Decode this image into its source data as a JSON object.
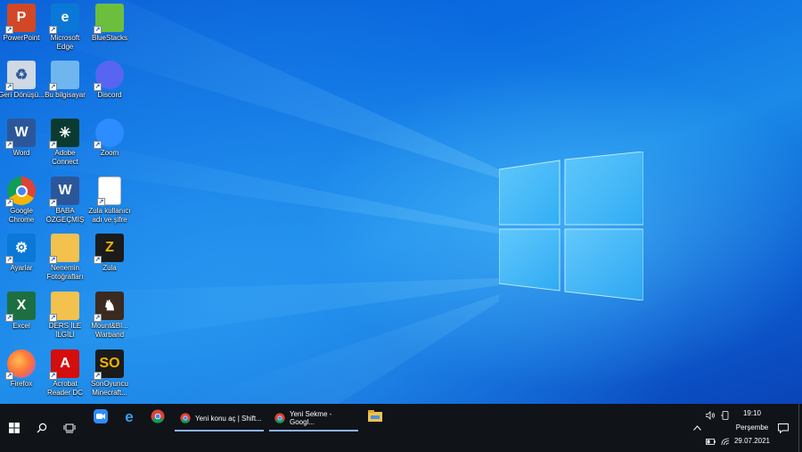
{
  "desktop": {
    "icons": [
      {
        "label": "PowerPoint",
        "icon": "powerpoint-icon",
        "glyph": "P",
        "color": "#d24726"
      },
      {
        "label": "Microsoft Edge",
        "icon": "edge-icon",
        "glyph": "e",
        "color": "#0a78d7"
      },
      {
        "label": "BlueStacks",
        "icon": "bluestacks-icon",
        "glyph": "",
        "color": "#6bbf3c"
      },
      {
        "label": "Geri Dönüşü...",
        "icon": "recycle-bin-icon",
        "glyph": "♻",
        "color": "#cfd8e3"
      },
      {
        "label": "Bu bilgisayar",
        "icon": "this-pc-icon",
        "glyph": "",
        "color": "#6fb6f0"
      },
      {
        "label": "Discord",
        "icon": "discord-icon",
        "glyph": "",
        "color": "#5865f2"
      },
      {
        "label": "Word",
        "icon": "word-icon",
        "glyph": "W",
        "color": "#2b579a"
      },
      {
        "label": "Adobe Connect",
        "icon": "adobe-connect-icon",
        "glyph": "✳",
        "color": "#0b3b30"
      },
      {
        "label": "Zoom",
        "icon": "zoom-icon",
        "glyph": "",
        "color": "#2d8cff"
      },
      {
        "label": "Google Chrome",
        "icon": "chrome-icon",
        "glyph": "",
        "color": "#ffffff"
      },
      {
        "label": "BABA ÖZGEÇMİŞ",
        "icon": "word-document-icon",
        "glyph": "W",
        "color": "#2b579a"
      },
      {
        "label": "Zula kullanıcı adı ve şifre",
        "icon": "text-file-icon",
        "glyph": "",
        "color": "#ffffff"
      },
      {
        "label": "Ayarlar",
        "icon": "settings-gear-icon",
        "glyph": "⚙",
        "color": "#0a78d7"
      },
      {
        "label": "Nenemin Fotoğrafları",
        "icon": "folder-icon",
        "glyph": "",
        "color": "#f2c14e"
      },
      {
        "label": "Zula",
        "icon": "zula-game-icon",
        "glyph": "Z",
        "color": "#1b1b1b"
      },
      {
        "label": "Excel",
        "icon": "excel-icon",
        "glyph": "X",
        "color": "#1d6f42"
      },
      {
        "label": "DERS İLE İLGİLİ",
        "icon": "folder-icon",
        "glyph": "",
        "color": "#f2c14e"
      },
      {
        "label": "Mount&Bl... Warband",
        "icon": "warband-game-icon",
        "glyph": "♞",
        "color": "#3a2a20"
      },
      {
        "label": "Firefox",
        "icon": "firefox-icon",
        "glyph": "",
        "color": "#ff7139"
      },
      {
        "label": "Acrobat Reader DC",
        "icon": "acrobat-icon",
        "glyph": "A",
        "color": "#d40d0d"
      },
      {
        "label": "SonOyuncu Minecraft...",
        "icon": "sonoyuncu-icon",
        "glyph": "SO",
        "color": "#1b1b1b"
      }
    ]
  },
  "taskbar": {
    "start_icon": "windows-start-icon",
    "search_icon": "search-icon",
    "taskview_icon": "task-view-icon",
    "pinned": [
      {
        "name": "zoom-taskbar-icon"
      },
      {
        "name": "edge-taskbar-icon"
      },
      {
        "name": "chrome-taskbar-icon"
      }
    ],
    "windows": [
      {
        "title": "Yeni konu aç | Shift..."
      },
      {
        "title": "Yeni Sekme - Googl..."
      }
    ],
    "explorer_icon": "file-explorer-icon",
    "tray": {
      "time": "19:10",
      "day": "Perşembe",
      "date": "29.07.2021"
    }
  }
}
